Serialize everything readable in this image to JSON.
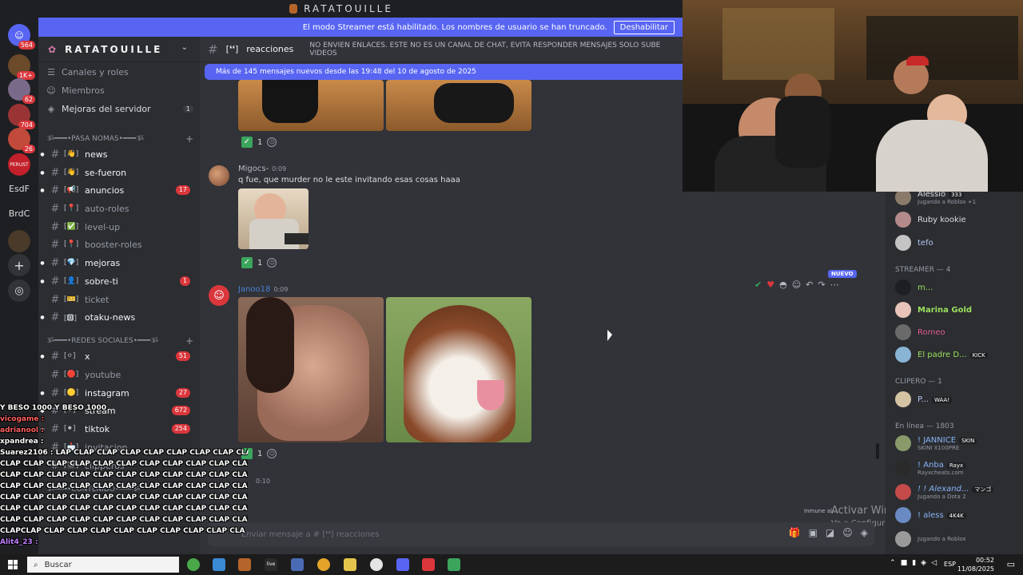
{
  "window": {
    "title": "RATATOUILLE"
  },
  "banner": {
    "text": "El modo Streamer está habilitado. Los nombres de usuario se han truncado.",
    "button": "Deshabilitar"
  },
  "rail": {
    "servers": [
      {
        "badge": "564"
      },
      {
        "badge": "1K+"
      },
      {
        "badge": "62"
      },
      {
        "badge": "704"
      },
      {
        "badge": "26"
      },
      {
        "label": "PERUST"
      },
      {
        "label": "EsdF"
      },
      {
        "label": "BrdC"
      }
    ]
  },
  "sidebar": {
    "server_name": "RATATOUILLE",
    "nav": [
      {
        "label": "Canales y roles"
      },
      {
        "label": "Miembros"
      },
      {
        "label": "Mejoras del servidor",
        "count": "1"
      }
    ],
    "categories": [
      {
        "label": "ૐ━━━•PASA NOMAS•━━━ૐ"
      },
      {
        "label": "ૐ━━━•REDES SOCIALES•━━━ૐ"
      },
      {
        "label": "ૐ━━━•CONTENIDO•━━━ૐ"
      }
    ],
    "channels": [
      {
        "emoji": "[👋]",
        "name": "news"
      },
      {
        "emoji": "[👋]",
        "name": "se-fueron"
      },
      {
        "emoji": "[📢]",
        "name": "anuncios",
        "badge": "17"
      },
      {
        "emoji": "[📍]",
        "name": "auto-roles"
      },
      {
        "emoji": "[✅]",
        "name": "level-up"
      },
      {
        "emoji": "[📍]",
        "name": "booster-roles"
      },
      {
        "emoji": "[💎]",
        "name": "mejoras"
      },
      {
        "emoji": "[👤]",
        "name": "sobre-ti",
        "badge": "1"
      },
      {
        "emoji": "[🎫]",
        "name": "ticket"
      },
      {
        "emoji": "[🅾]",
        "name": "otaku-news"
      },
      {
        "emoji": "[⚪]",
        "name": "x",
        "badge": "51"
      },
      {
        "emoji": "[🔴]",
        "name": "youtube"
      },
      {
        "emoji": "[🟡]",
        "name": "instagram",
        "badge": "27"
      },
      {
        "emoji": "[⚫]",
        "name": "stream",
        "badge": "672"
      },
      {
        "emoji": "[⚫]",
        "name": "tiktok",
        "badge": "254"
      },
      {
        "emoji": "[📩]",
        "name": "invitacion"
      },
      {
        "emoji": "[🎬]",
        "name": "clipperos"
      }
    ]
  },
  "channel": {
    "emoji": "[❛❛]",
    "name": "reacciones",
    "topic": "NO ENVIEN ENLACES. ESTE NO ES UN CANAL DE CHAT, EVITA RESPONDER MENSAJES SOLO SUBE VIDEOS",
    "new_messages": "Más de 145 mensajes nuevos desde las 19:48 del 10 de agosto de 2025"
  },
  "messages": [
    {
      "reaction_count": "1"
    },
    {
      "author": "Migocs-",
      "time": "0:09",
      "text": "q fue, que murder no le este invitando esas cosas haaa",
      "reaction_count": "1"
    },
    {
      "author": "Janoo18",
      "time": "0:09",
      "badge": "NUEVO",
      "reaction_count": "1"
    },
    {
      "time": "0:10"
    }
  ],
  "composer": {
    "placeholder": "Enviar mensaje a # [❛❛] reacciones"
  },
  "typing": "Inmune al…",
  "watermark": {
    "line1": "Activar Windows",
    "line2": "Ve a Configuración para activar Windows."
  },
  "members": {
    "top": [
      {
        "name": "Alessio",
        "sub": "Jugando a Roblox +1",
        "tag": "333"
      },
      {
        "name": "Ruby kookie"
      },
      {
        "name": "tefo"
      }
    ],
    "groups": [
      {
        "label": "STREAMER — 4",
        "items": [
          {
            "name": "m..."
          },
          {
            "name": "Marina Gold"
          },
          {
            "name": "Romeo"
          },
          {
            "name": "El padre D...",
            "tag": "KICK"
          }
        ]
      },
      {
        "label": "CLIPERO — 1",
        "items": [
          {
            "name": "P...",
            "tag": "WAA!"
          }
        ]
      },
      {
        "label": "En línea — 1803",
        "items": [
          {
            "name": "! JANNICE",
            "sub": "SKINI X100PRE",
            "tag": "SKIN"
          },
          {
            "name": "! Anba",
            "sub": "Rayxcheats.com",
            "tag": "Rayx"
          },
          {
            "name": "! ! Alexand...",
            "sub": "Jugando a Dota 2",
            "tag": "マンゴ"
          },
          {
            "name": "! aless",
            "tag": "4K4K"
          },
          {
            "name": "",
            "sub": "Jugando a Roblox"
          }
        ]
      }
    ]
  },
  "stream_chat": [
    "Y BESO 1000 Y BESO 1000",
    "vicogame :",
    "adrianool :",
    "xpandrea :",
    "Suarez2106 : LAP CLAP CLAP CLAP CLAP CLAP CLAP CLAP CLAP CL",
    "CLAP CLAP CLAP CLAP CLAP CLAP CLAP CLAP CLAP CLAP CLAP CLA",
    "CLAP CLAP CLAP CLAP CLAP CLAP CLAP CLAP CLAP CLAP CLAP CLA",
    "CLAP CLAP CLAP CLAP CLAP CLAP CLAP CLAP CLAP CLAP CLAP CLA",
    "CLAP CLAP CLAP CLAP CLAP CLAP CLAP CLAP CLAP CLAP CLAP CLA",
    "CLAP CLAP CLAP CLAP CLAP CLAP CLAP CLAP CLAP CLAP CLAP CLA",
    "CLAP CLAP CLAP CLAP CLAP CLAP CLAP CLAP CLAP CLAP CLAP CLA",
    "CLAPCLAP CLAP CLAP CLAP CLAP CLAP CLAP CLAP CLAP CLA",
    "Alit4_23 :"
  ],
  "taskbar": {
    "search": "Buscar",
    "lang": "ESP",
    "time": "00:52",
    "date": "11/08/2025"
  }
}
